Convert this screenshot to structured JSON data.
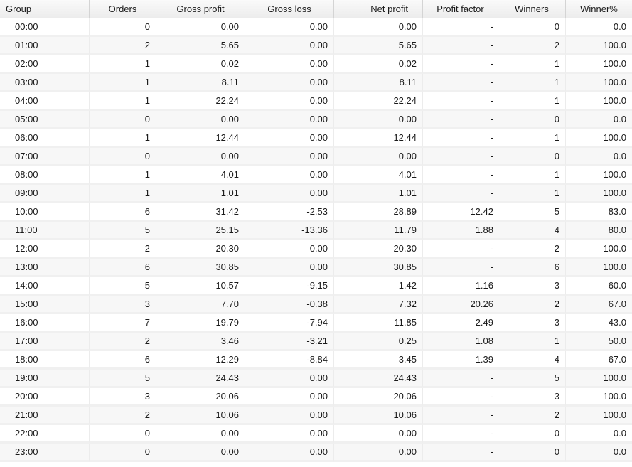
{
  "table": {
    "columns": [
      "Group",
      "Orders",
      "Gross profit",
      "Gross loss",
      "Net profit",
      "Profit factor",
      "Winners",
      "Winner%"
    ],
    "rows": [
      [
        "00:00",
        "0",
        "0.00",
        "0.00",
        "0.00",
        "-",
        "0",
        "0.0"
      ],
      [
        "01:00",
        "2",
        "5.65",
        "0.00",
        "5.65",
        "-",
        "2",
        "100.0"
      ],
      [
        "02:00",
        "1",
        "0.02",
        "0.00",
        "0.02",
        "-",
        "1",
        "100.0"
      ],
      [
        "03:00",
        "1",
        "8.11",
        "0.00",
        "8.11",
        "-",
        "1",
        "100.0"
      ],
      [
        "04:00",
        "1",
        "22.24",
        "0.00",
        "22.24",
        "-",
        "1",
        "100.0"
      ],
      [
        "05:00",
        "0",
        "0.00",
        "0.00",
        "0.00",
        "-",
        "0",
        "0.0"
      ],
      [
        "06:00",
        "1",
        "12.44",
        "0.00",
        "12.44",
        "-",
        "1",
        "100.0"
      ],
      [
        "07:00",
        "0",
        "0.00",
        "0.00",
        "0.00",
        "-",
        "0",
        "0.0"
      ],
      [
        "08:00",
        "1",
        "4.01",
        "0.00",
        "4.01",
        "-",
        "1",
        "100.0"
      ],
      [
        "09:00",
        "1",
        "1.01",
        "0.00",
        "1.01",
        "-",
        "1",
        "100.0"
      ],
      [
        "10:00",
        "6",
        "31.42",
        "-2.53",
        "28.89",
        "12.42",
        "5",
        "83.0"
      ],
      [
        "11:00",
        "5",
        "25.15",
        "-13.36",
        "11.79",
        "1.88",
        "4",
        "80.0"
      ],
      [
        "12:00",
        "2",
        "20.30",
        "0.00",
        "20.30",
        "-",
        "2",
        "100.0"
      ],
      [
        "13:00",
        "6",
        "30.85",
        "0.00",
        "30.85",
        "-",
        "6",
        "100.0"
      ],
      [
        "14:00",
        "5",
        "10.57",
        "-9.15",
        "1.42",
        "1.16",
        "3",
        "60.0"
      ],
      [
        "15:00",
        "3",
        "7.70",
        "-0.38",
        "7.32",
        "20.26",
        "2",
        "67.0"
      ],
      [
        "16:00",
        "7",
        "19.79",
        "-7.94",
        "11.85",
        "2.49",
        "3",
        "43.0"
      ],
      [
        "17:00",
        "2",
        "3.46",
        "-3.21",
        "0.25",
        "1.08",
        "1",
        "50.0"
      ],
      [
        "18:00",
        "6",
        "12.29",
        "-8.84",
        "3.45",
        "1.39",
        "4",
        "67.0"
      ],
      [
        "19:00",
        "5",
        "24.43",
        "0.00",
        "24.43",
        "-",
        "5",
        "100.0"
      ],
      [
        "20:00",
        "3",
        "20.06",
        "0.00",
        "20.06",
        "-",
        "3",
        "100.0"
      ],
      [
        "21:00",
        "2",
        "10.06",
        "0.00",
        "10.06",
        "-",
        "2",
        "100.0"
      ],
      [
        "22:00",
        "0",
        "0.00",
        "0.00",
        "0.00",
        "-",
        "0",
        "0.0"
      ],
      [
        "23:00",
        "0",
        "0.00",
        "0.00",
        "0.00",
        "-",
        "0",
        "0.0"
      ]
    ]
  }
}
